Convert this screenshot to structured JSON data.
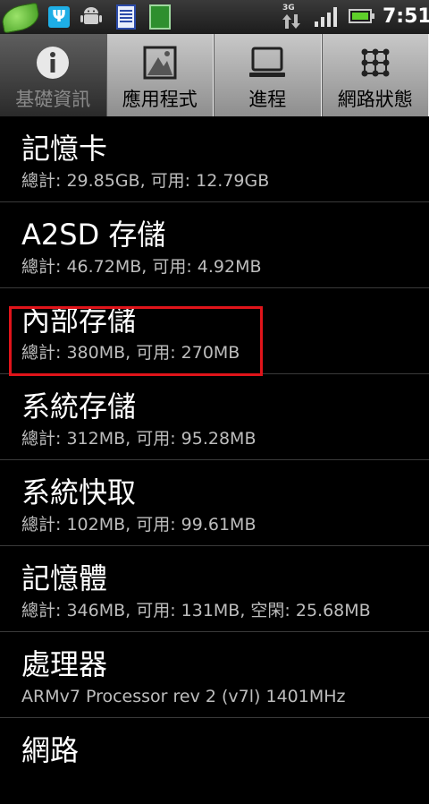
{
  "status_bar": {
    "network_type": "3G",
    "time": "7:51",
    "icons": [
      "leaf-app-icon",
      "usb-icon",
      "android-debug-icon",
      "notes-icon",
      "sdcard-icon",
      "data-arrows-icon",
      "signal-icon",
      "battery-icon"
    ]
  },
  "tabs": [
    {
      "label": "基礎資訊",
      "icon": "info-icon",
      "active": true
    },
    {
      "label": "應用程式",
      "icon": "apps-icon",
      "active": false
    },
    {
      "label": "進程",
      "icon": "monitor-icon",
      "active": false
    },
    {
      "label": "網路狀態",
      "icon": "network-grid-icon",
      "active": false
    }
  ],
  "items": [
    {
      "title": "記憶卡",
      "subtitle": "總計: 29.85GB, 可用: 12.79GB"
    },
    {
      "title": "A2SD 存儲",
      "subtitle": "總計: 46.72MB, 可用: 4.92MB"
    },
    {
      "title": "內部存儲",
      "subtitle": "總計: 380MB, 可用: 270MB"
    },
    {
      "title": "系統存儲",
      "subtitle": "總計: 312MB, 可用: 95.28MB"
    },
    {
      "title": "系統快取",
      "subtitle": "總計: 102MB, 可用: 99.61MB"
    },
    {
      "title": "記憶體",
      "subtitle": "總計: 346MB, 可用: 131MB, 空閑: 25.68MB"
    },
    {
      "title": "處理器",
      "subtitle": "ARMv7 Processor rev 2 (v7l)  1401MHz"
    },
    {
      "title": "網路",
      "subtitle": ""
    }
  ],
  "colors": {
    "highlight": "#e0141a",
    "background": "#000000"
  }
}
